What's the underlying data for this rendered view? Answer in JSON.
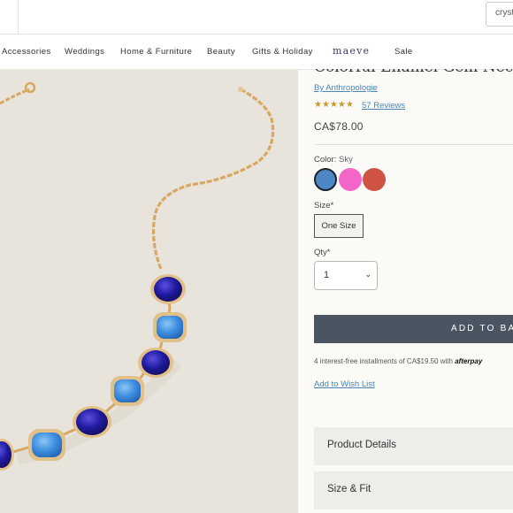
{
  "header": {
    "search_placeholder": "cryst"
  },
  "nav": {
    "items": [
      "Accessories",
      "Weddings",
      "Home & Furniture",
      "Beauty",
      "Gifts & Holiday",
      "maeve",
      "Sale"
    ]
  },
  "product": {
    "title": "Colorful Enamel Gem Neckla",
    "by_label": "By Anthropologie",
    "rating_stars": "★★★★★",
    "rating": 4.5,
    "reviews_label": "57 Reviews",
    "price": "CA$78.00",
    "color_label": "Color:",
    "color_value": "Sky",
    "swatch_colors": [
      "#4f86c6",
      "#f465c8",
      "#cf5344"
    ],
    "size_label": "Size*",
    "size_option": "One Size",
    "qty_label": "Qty*",
    "qty_value": "1",
    "add_to_basket": "ADD TO BAS",
    "installments_text": "4 interest-free installments of CA$19.50 with",
    "afterpay": "afterpay",
    "wishlist": "Add to Wish List",
    "accordion": [
      "Product Details",
      "Size & Fit"
    ]
  }
}
